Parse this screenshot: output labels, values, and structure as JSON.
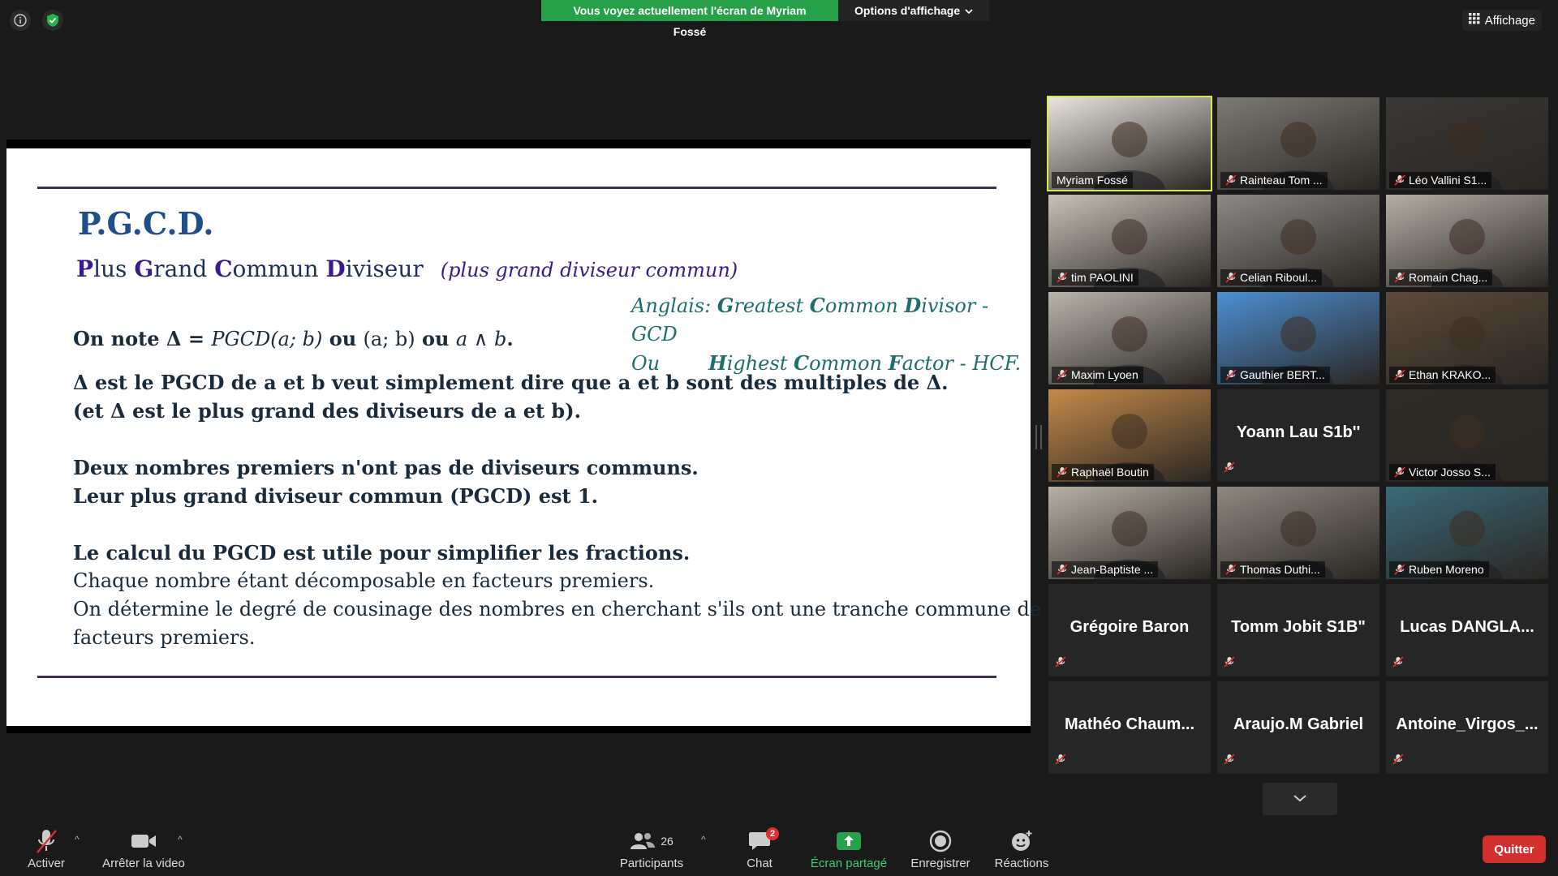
{
  "top": {
    "banner_message": "Vous voyez actuellement l'écran de Myriam Fossé",
    "options_label": "Options d'affichage",
    "view_label": "Affichage"
  },
  "slide": {
    "title": "P.G.C.D.",
    "subtitle_letters": [
      "P",
      "G",
      "C",
      "D"
    ],
    "subtitle_rest": [
      "lus ",
      "rand ",
      "ommun ",
      "iviseur"
    ],
    "subtitle_note": "(plus grand diviseur commun)",
    "english_line1_prefix": "Anglais: ",
    "english_line1_bold": [
      "G",
      "C",
      "D"
    ],
    "english_line1_words": [
      "reatest ",
      "ommon ",
      "ivisor - GCD"
    ],
    "english_line2_prefix": "Ou",
    "english_line2_bold": [
      "H",
      "C",
      "F"
    ],
    "english_line2_words": [
      "ighest ",
      "ommon ",
      "actor - HCF."
    ],
    "notation_pre": "On note Δ = ",
    "notation_math": "PGCD(a; b)",
    "notation_mid": " ou ",
    "notation_math2": "(a; b)",
    "notation_mid2": " ou ",
    "notation_math3": "a ∧ b",
    "notation_end": ".",
    "line_def1": "Δ est le PGCD de a et b veut simplement dire que a et b sont des multiples de Δ.",
    "line_def2": "(et Δ est le plus grand des diviseurs de a et b).",
    "line_prime1": "Deux nombres premiers n'ont pas de diviseurs communs.",
    "line_prime2": "Leur plus grand diviseur commun (PGCD) est 1.",
    "line_calc1": "Le calcul du PGCD est utile pour simplifier les fractions.",
    "line_calc2": "Chaque nombre étant décomposable en facteurs premiers.",
    "line_calc3": "On détermine le degré de cousinage des nombres en cherchant s'ils ont une tranche commune de",
    "line_calc4": "facteurs premiers."
  },
  "participants": [
    {
      "name": "Myriam Fossé",
      "video": true,
      "muted": false,
      "active": true,
      "bg": "#e9e4de"
    },
    {
      "name": "Rainteau Tom ...",
      "video": true,
      "muted": true,
      "bg": "#7d7a75"
    },
    {
      "name": "Léo Vallini S1...",
      "video": true,
      "muted": true,
      "bg": "#3a3836"
    },
    {
      "name": "tim PAOLINI",
      "video": true,
      "muted": true,
      "bg": "#c8c1b8"
    },
    {
      "name": "Celian Riboul...",
      "video": true,
      "muted": true,
      "bg": "#8c8a86"
    },
    {
      "name": "Romain Chag...",
      "video": true,
      "muted": true,
      "bg": "#b5aea6"
    },
    {
      "name": "Maxim Lyoen",
      "video": true,
      "muted": true,
      "bg": "#b9b4ab"
    },
    {
      "name": "Gauthier BERT...",
      "video": true,
      "muted": true,
      "bg": "#4c8fd1"
    },
    {
      "name": "Ethan KRAKO...",
      "video": true,
      "muted": true,
      "bg": "#5c4a3a"
    },
    {
      "name": "Raphaël Boutin",
      "video": true,
      "muted": true,
      "bg": "#c48a4a"
    },
    {
      "name": "Yoann Lau S1b''",
      "video": false,
      "muted": true
    },
    {
      "name": "Victor Josso S...",
      "video": true,
      "muted": true,
      "bg": "#2e2a26"
    },
    {
      "name": "Jean-Baptiste ...",
      "video": true,
      "muted": true,
      "bg": "#b8b0a6"
    },
    {
      "name": "Thomas Duthi...",
      "video": true,
      "muted": true,
      "bg": "#8f8880"
    },
    {
      "name": "Ruben Moreno",
      "video": true,
      "muted": true,
      "bg": "#3a6a7a"
    },
    {
      "name": "Grégoire Baron",
      "video": false,
      "muted": true
    },
    {
      "name": "Tomm Jobit S1B\"",
      "video": false,
      "muted": true
    },
    {
      "name": "Lucas DANGLA...",
      "video": false,
      "muted": true
    },
    {
      "name": "Mathéo Chaum...",
      "video": false,
      "muted": true
    },
    {
      "name": "Araujo.M Gabriel",
      "video": false,
      "muted": true
    },
    {
      "name": "Antoine_Virgos_...",
      "video": false,
      "muted": true
    }
  ],
  "toolbar": {
    "unmute_label": "Activer",
    "stop_video_label": "Arrêter la video",
    "participants_label": "Participants",
    "participants_count": "26",
    "chat_label": "Chat",
    "chat_badge": "2",
    "share_label": "Écran partagé",
    "record_label": "Enregistrer",
    "reactions_label": "Réactions",
    "quit_label": "Quitter"
  },
  "colors": {
    "share_green": "#26a14a",
    "quit_red": "#d32f2f",
    "active_speaker": "#d6e84b"
  }
}
